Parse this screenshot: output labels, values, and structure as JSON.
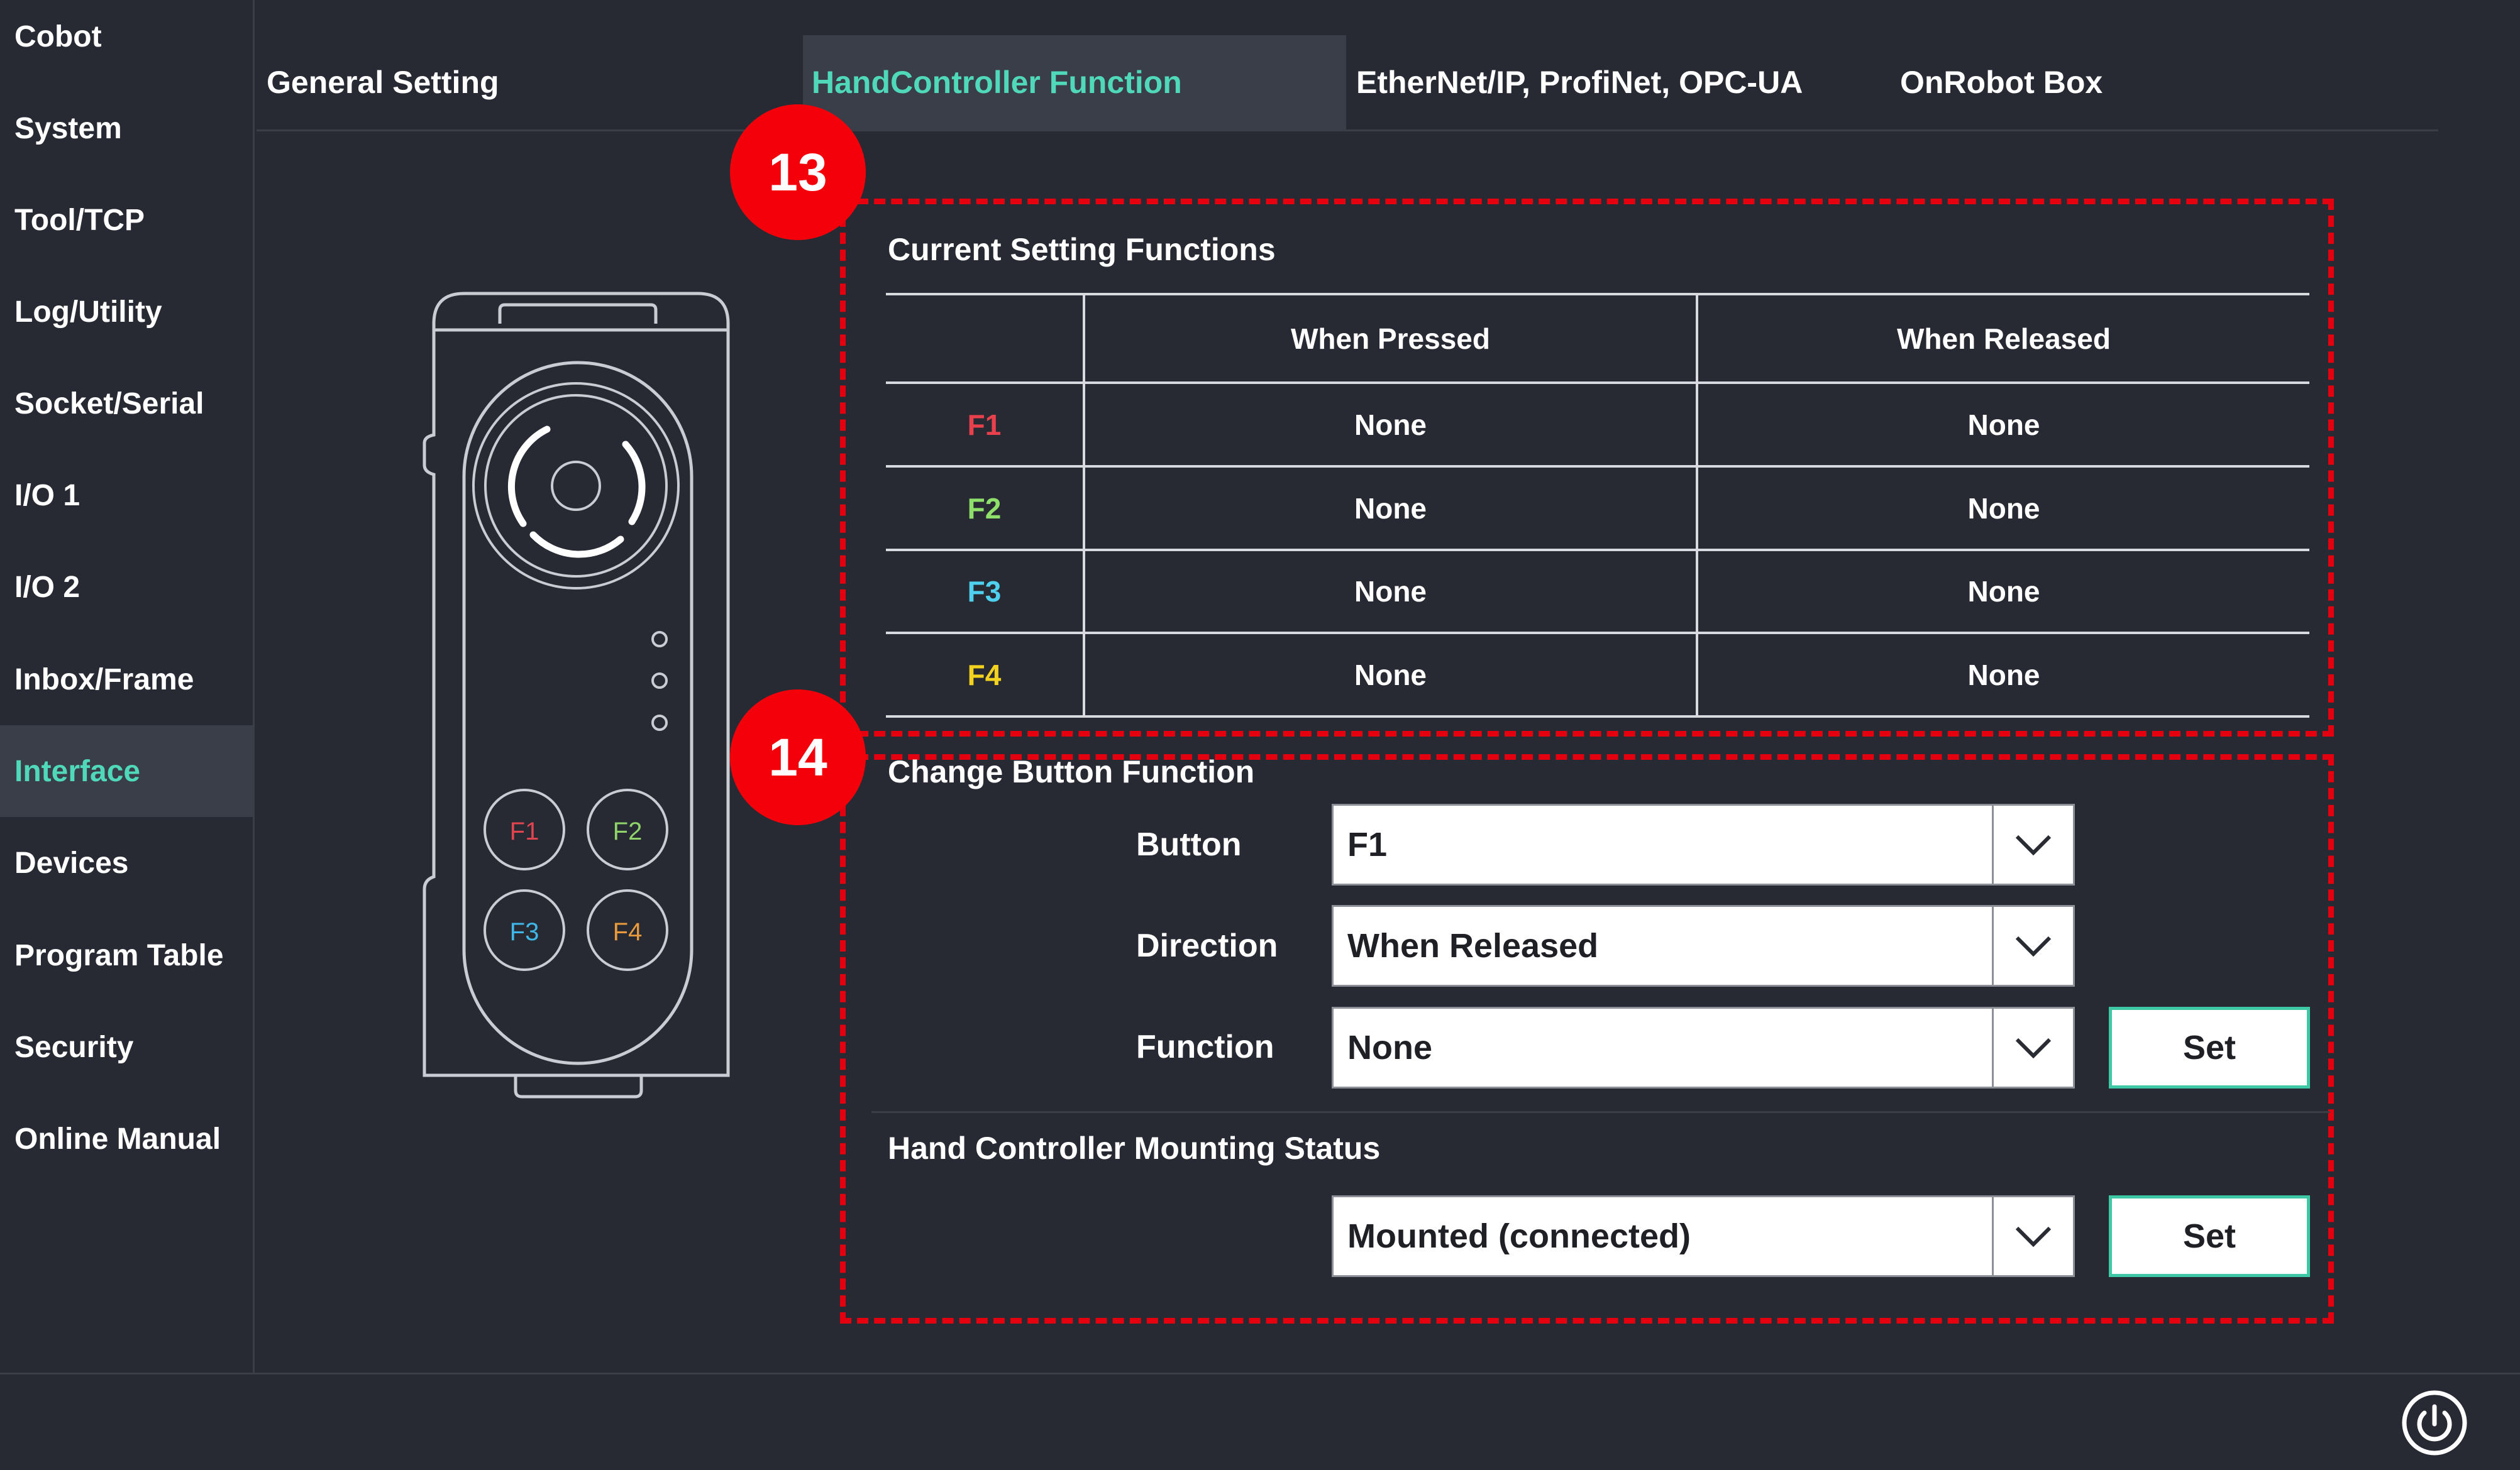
{
  "sidebar": {
    "items": [
      {
        "label": "Cobot",
        "active": false
      },
      {
        "label": "System",
        "active": false
      },
      {
        "label": "Tool/TCP",
        "active": false
      },
      {
        "label": "Log/Utility",
        "active": false
      },
      {
        "label": "Socket/Serial",
        "active": false
      },
      {
        "label": "I/O 1",
        "active": false
      },
      {
        "label": "I/O 2",
        "active": false
      },
      {
        "label": "Inbox/Frame",
        "active": false
      },
      {
        "label": "Interface",
        "active": true
      },
      {
        "label": "Devices",
        "active": false
      },
      {
        "label": "Program Table",
        "active": false
      },
      {
        "label": "Security",
        "active": false
      },
      {
        "label": "Online Manual",
        "active": false
      }
    ]
  },
  "tabs": [
    {
      "label": "General Setting",
      "active": false
    },
    {
      "label": "HandController Function",
      "active": true
    },
    {
      "label": "EtherNet/IP, ProfiNet, OPC-UA",
      "active": false
    },
    {
      "label": "OnRobot Box",
      "active": false
    }
  ],
  "callouts": {
    "first": "13",
    "second": "14"
  },
  "controller": {
    "buttons": [
      {
        "label": "F1",
        "color": "#e0454f"
      },
      {
        "label": "F2",
        "color": "#8fd36a"
      },
      {
        "label": "F3",
        "color": "#3fb7e8"
      },
      {
        "label": "F4",
        "color": "#e89a3c"
      }
    ]
  },
  "current_settings": {
    "title": "Current Setting Functions",
    "columns": [
      "When Pressed",
      "When Released"
    ],
    "rows": [
      {
        "button": "F1",
        "color": "#e8414d",
        "pressed": "None",
        "released": "None"
      },
      {
        "button": "F2",
        "color": "#8fe06b",
        "pressed": "None",
        "released": "None"
      },
      {
        "button": "F3",
        "color": "#4fd0ee",
        "pressed": "None",
        "released": "None"
      },
      {
        "button": "F4",
        "color": "#f2d21e",
        "pressed": "None",
        "released": "None"
      }
    ]
  },
  "change_function": {
    "title": "Change Button Function",
    "button_label": "Button",
    "button_value": "F1",
    "direction_label": "Direction",
    "direction_value": "When Released",
    "function_label": "Function",
    "function_value": "None",
    "set_label": "Set"
  },
  "mounting": {
    "title": "Hand Controller Mounting Status",
    "value": "Mounted (connected)",
    "set_label": "Set"
  },
  "colors": {
    "accent": "#4fd8ba",
    "background": "#272a32",
    "callout": "#e4000f"
  }
}
